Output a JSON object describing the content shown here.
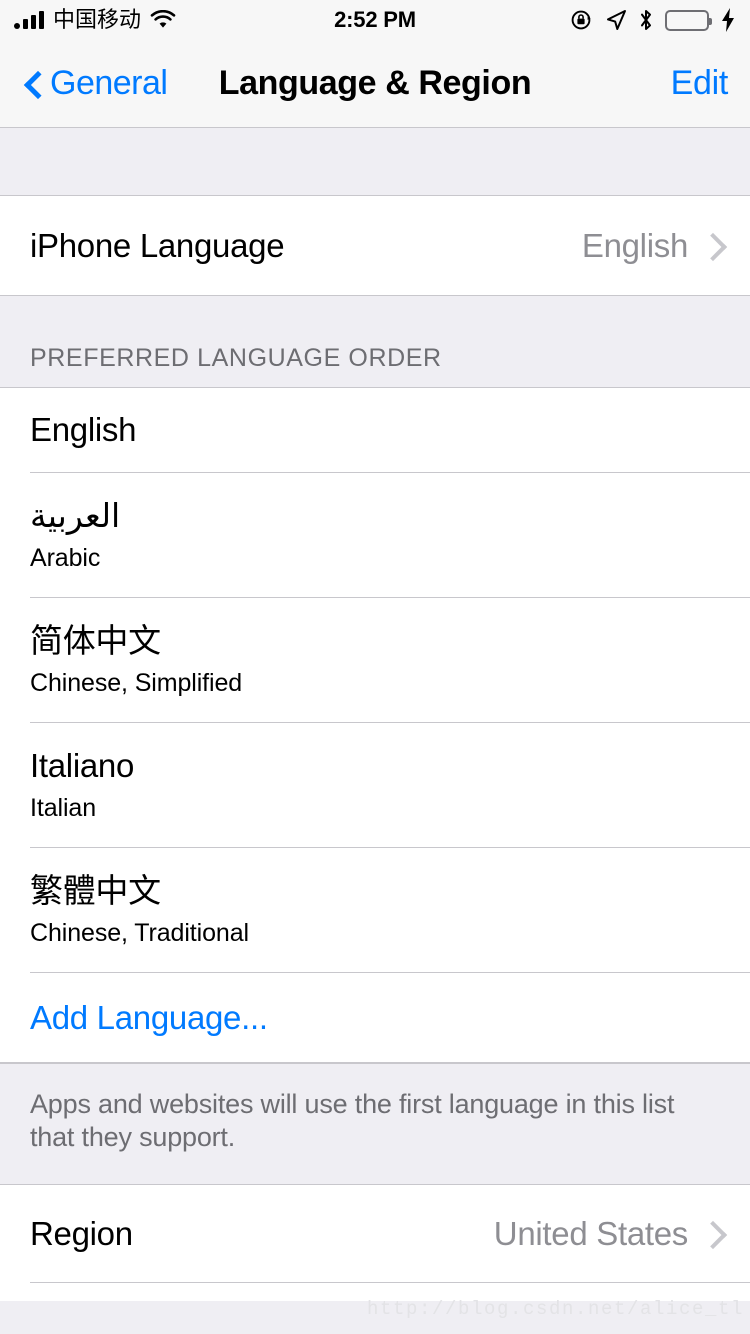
{
  "status_bar": {
    "carrier": "中国移动",
    "time": "2:52 PM",
    "signal_bars": 4,
    "icons": [
      "signal-bars-icon",
      "wifi-icon",
      "rotation-lock-icon",
      "location-arrow-icon",
      "bluetooth-icon",
      "battery-icon",
      "charging-bolt-icon"
    ],
    "battery_color": "#4cd964",
    "battery_charging": true
  },
  "nav_bar": {
    "back_label": "General",
    "title": "Language & Region",
    "edit_label": "Edit",
    "tint_color": "#007aff"
  },
  "iphone_language_row": {
    "title": "iPhone Language",
    "value": "English"
  },
  "preferred_section": {
    "header": "PREFERRED LANGUAGE ORDER",
    "items": [
      {
        "native": "English",
        "english": "",
        "rtl": false
      },
      {
        "native": "العربية",
        "english": "Arabic",
        "rtl": true
      },
      {
        "native": "简体中文",
        "english": "Chinese, Simplified",
        "rtl": false
      },
      {
        "native": "Italiano",
        "english": "Italian",
        "rtl": false
      },
      {
        "native": "繁體中文",
        "english": "Chinese, Traditional",
        "rtl": false
      }
    ],
    "add_language_label": "Add Language...",
    "footer": "Apps and websites will use the first language in this list that they support."
  },
  "region_row": {
    "title": "Region",
    "value": "United States"
  },
  "watermark": "http://blog.csdn.net/alice_tl"
}
